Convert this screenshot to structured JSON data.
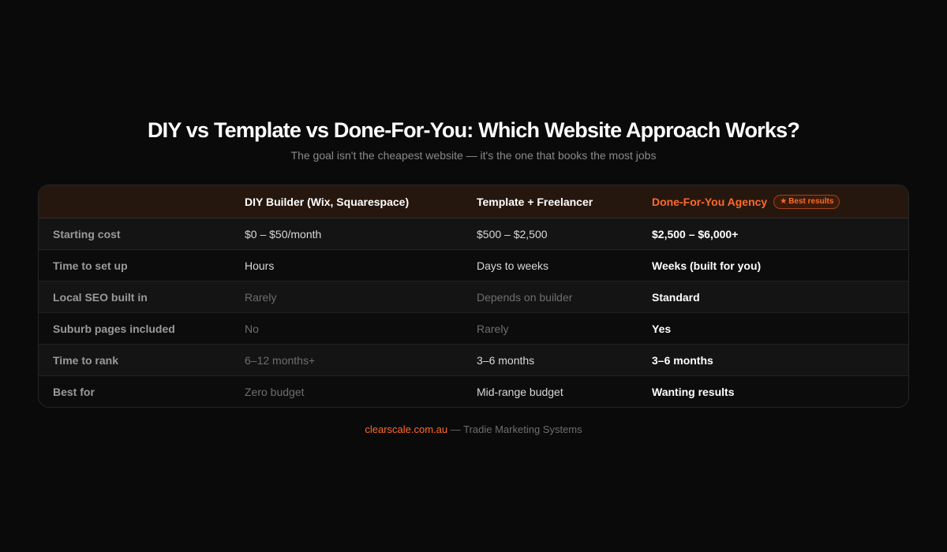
{
  "header": {
    "title": "DIY vs Template vs Done-For-You: Which Website Approach Works?",
    "subtitle": "The goal isn't the cheapest website — it's the one that books the most jobs"
  },
  "table": {
    "columns": [
      "",
      "DIY Builder (Wix, Squarespace)",
      "Template + Freelancer",
      "Done-For-You Agency"
    ],
    "badge": {
      "icon": "star-icon",
      "text": "Best results"
    },
    "rows": [
      {
        "label": "Starting cost",
        "diy": "$0 – $50/month",
        "template": "$500 – $2,500",
        "agency": "$2,500 – $6,000+"
      },
      {
        "label": "Time to set up",
        "diy": "Hours",
        "template": "Days to weeks",
        "agency": "Weeks (built for you)"
      },
      {
        "label": "Local SEO built in",
        "diy": "Rarely",
        "template": "Depends on builder",
        "agency": "Standard"
      },
      {
        "label": "Suburb pages included",
        "diy": "No",
        "template": "Rarely",
        "agency": "Yes"
      },
      {
        "label": "Time to rank",
        "diy": "6–12 months+",
        "template": "3–6 months",
        "agency": "3–6 months"
      },
      {
        "label": "Best for",
        "diy": "Zero budget",
        "template": "Mid-range budget",
        "agency": "Wanting results"
      }
    ]
  },
  "footer": {
    "brand": "clearscale.com.au",
    "tagline": " — Tradie Marketing Systems"
  },
  "colors": {
    "accent": "#ff6a2b",
    "background": "#0a0a0a",
    "header_row": "#26170e"
  }
}
